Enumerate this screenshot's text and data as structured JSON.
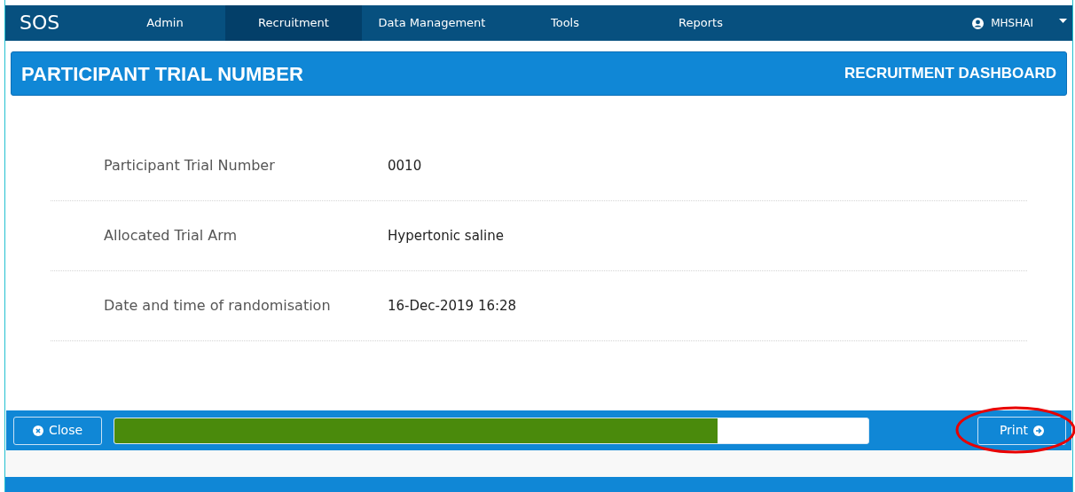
{
  "nav": {
    "brand": "SOS",
    "items": [
      {
        "label": "Admin",
        "selected": false
      },
      {
        "label": "Recruitment",
        "selected": true
      },
      {
        "label": "Data Management",
        "selected": false
      },
      {
        "label": "Tools",
        "selected": false
      },
      {
        "label": "Reports",
        "selected": false
      }
    ],
    "user": "MHSHAI"
  },
  "header": {
    "title": "PARTICIPANT TRIAL NUMBER",
    "link": "RECRUITMENT DASHBOARD"
  },
  "details": [
    {
      "label": "Participant Trial Number",
      "value": "0010"
    },
    {
      "label": "Allocated Trial Arm",
      "value": "Hypertonic saline"
    },
    {
      "label": "Date and time of randomisation",
      "value": "16-Dec-2019 16:28"
    }
  ],
  "footer": {
    "close_button": "Close",
    "progress": {
      "level": 0.8
    },
    "print_button": "Print"
  }
}
